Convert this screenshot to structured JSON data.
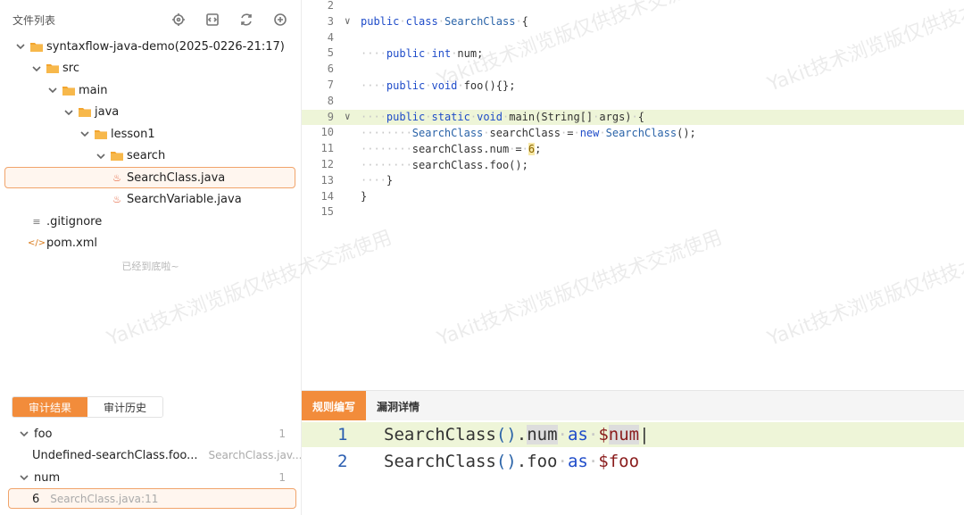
{
  "file_panel": {
    "title": "文件列表",
    "bottom_note": "已经到底啦~",
    "tree": [
      {
        "label": "syntaxflow-java-demo(2025-0226-21:17)",
        "type": "folder",
        "depth": 0
      },
      {
        "label": "src",
        "type": "folder",
        "depth": 1
      },
      {
        "label": "main",
        "type": "folder",
        "depth": 2
      },
      {
        "label": "java",
        "type": "folder",
        "depth": 3
      },
      {
        "label": "lesson1",
        "type": "folder",
        "depth": 4
      },
      {
        "label": "search",
        "type": "folder",
        "depth": 5
      },
      {
        "label": "SearchClass.java",
        "type": "java",
        "depth": 6,
        "selected": true
      },
      {
        "label": "SearchVariable.java",
        "type": "java",
        "depth": 6
      },
      {
        "label": ".gitignore",
        "type": "text",
        "depth": 1
      },
      {
        "label": "pom.xml",
        "type": "xml",
        "depth": 1
      }
    ]
  },
  "audit": {
    "tabs": [
      "审计结果",
      "审计历史"
    ],
    "groups": [
      {
        "label": "foo",
        "count": "1",
        "item": "Undefined-searchClass.foo...",
        "file": "SearchClass.jav..."
      },
      {
        "label": "num",
        "count": "1",
        "item": "6",
        "file": "SearchClass.java:11"
      }
    ]
  },
  "editor": {
    "line_numbers": [
      "2",
      "3",
      "4",
      "5",
      "6",
      "7",
      "8",
      "9",
      "10",
      "11",
      "12",
      "13",
      "14",
      "15"
    ]
  },
  "rule_panel": {
    "tabs": [
      "规则编写",
      "漏洞详情"
    ],
    "lines": [
      {
        "n": "1",
        "text": "SearchClass().num as $num"
      },
      {
        "n": "2",
        "text": "SearchClass().foo as $foo"
      }
    ]
  },
  "watermark": "Yakit技术浏览版仅供技术交流使用",
  "colors": {
    "accent": "#f28c3b",
    "keyword": "#1f4cc9",
    "line_highlight": "#eef5d8"
  }
}
